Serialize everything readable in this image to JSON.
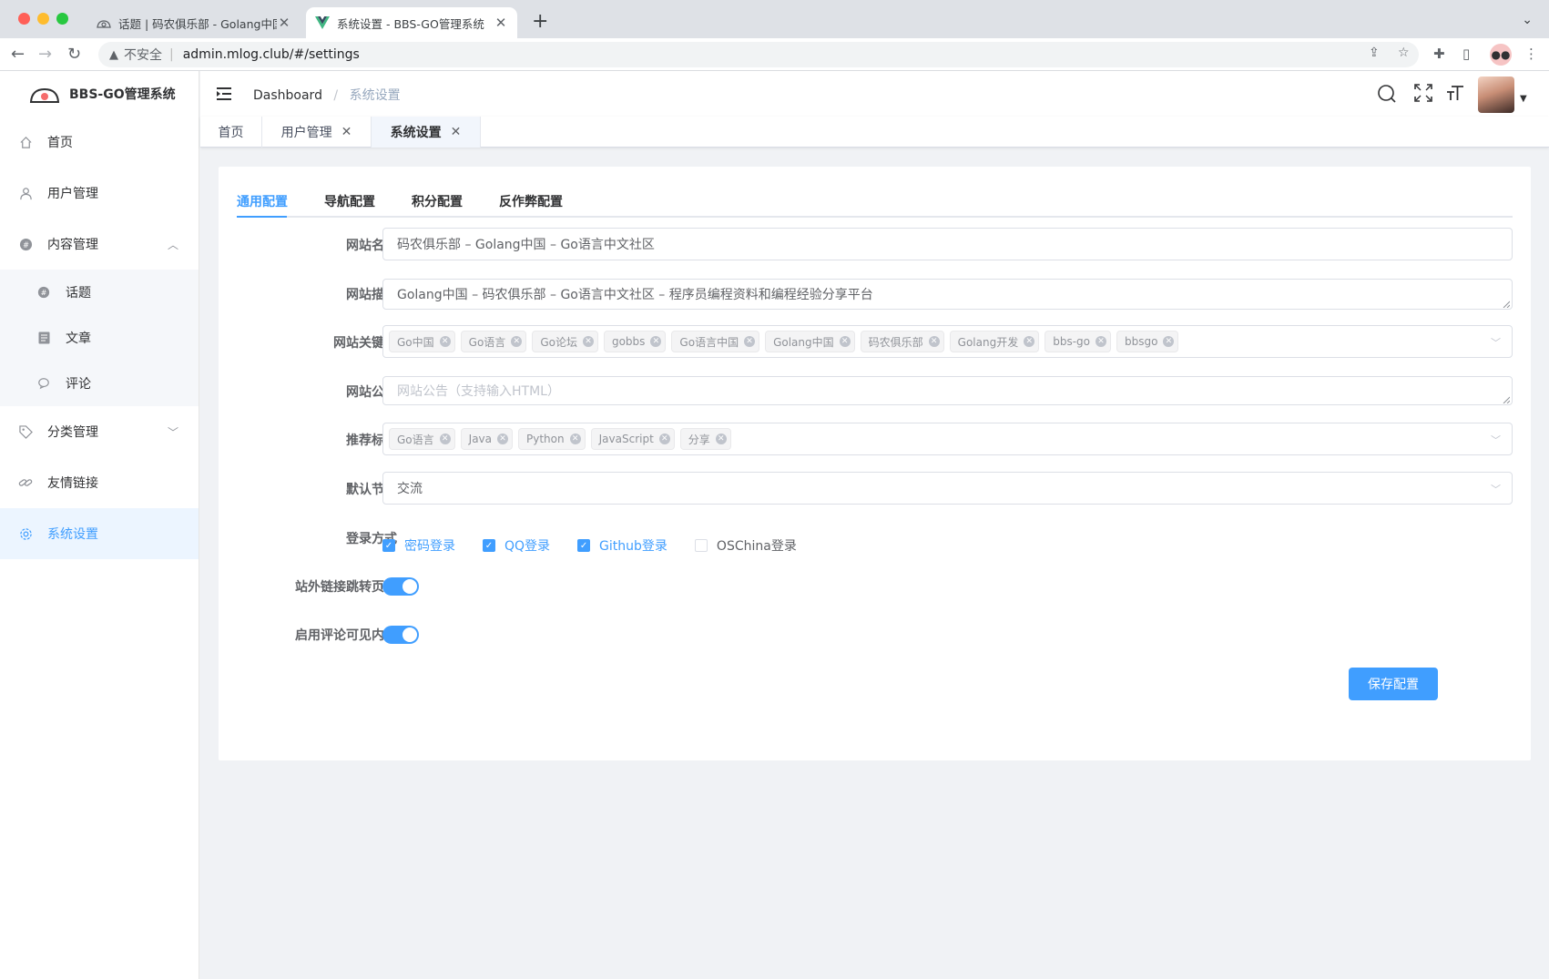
{
  "browser": {
    "tabs": [
      {
        "title": "话题 | 码农俱乐部 - Golang中国",
        "close": "✕"
      },
      {
        "title": "系统设置 - BBS-GO管理系统",
        "close": "✕"
      }
    ],
    "new_tab": "+",
    "insecure_label": "不安全",
    "url": "admin.mlog.club/#/settings"
  },
  "app": {
    "logo_text": "BBS-GO管理系统"
  },
  "sidebar": {
    "items": [
      {
        "label": "首页",
        "icon": "home-icon"
      },
      {
        "label": "用户管理",
        "icon": "user-icon"
      },
      {
        "label": "内容管理",
        "icon": "content-icon"
      },
      {
        "label": "分类管理",
        "icon": "tag-icon"
      },
      {
        "label": "友情链接",
        "icon": "link-icon"
      },
      {
        "label": "系统设置",
        "icon": "gear-icon"
      }
    ],
    "content_children": [
      {
        "label": "话题",
        "icon": "topic-icon"
      },
      {
        "label": "文章",
        "icon": "article-icon"
      },
      {
        "label": "评论",
        "icon": "comment-icon"
      }
    ]
  },
  "breadcrumb": {
    "root": "Dashboard",
    "separator": "/",
    "current": "系统设置"
  },
  "tagsview": {
    "tabs": [
      {
        "label": "首页"
      },
      {
        "label": "用户管理",
        "close": "✕"
      },
      {
        "label": "系统设置",
        "close": "✕"
      }
    ]
  },
  "settings": {
    "tabs": [
      "通用配置",
      "导航配置",
      "积分配置",
      "反作弊配置"
    ],
    "site_name": {
      "label": "网站名称",
      "value": "码农俱乐部  – Golang中国 – Go语言中文社区"
    },
    "site_desc": {
      "label": "网站描述",
      "value": "Golang中国 – 码农俱乐部 – Go语言中文社区 – 程序员编程资料和编程经验分享平台"
    },
    "site_keywords": {
      "label": "网站关键字",
      "values": [
        "Go中国",
        "Go语言",
        "Go论坛",
        "gobbs",
        "Go语言中国",
        "Golang中国",
        "码农俱乐部",
        "Golang开发",
        "bbs-go",
        "bbsgo"
      ]
    },
    "site_notice": {
      "label": "网站公告",
      "placeholder": "网站公告（支持输入HTML）"
    },
    "recommend_tags": {
      "label": "推荐标签",
      "values": [
        "Go语言",
        "Java",
        "Python",
        "JavaScript",
        "分享"
      ]
    },
    "default_node": {
      "label": "默认节点",
      "value": "交流"
    },
    "login_methods": {
      "label": "登录方式",
      "options": [
        {
          "label": "密码登录",
          "checked": true
        },
        {
          "label": "QQ登录",
          "checked": true
        },
        {
          "label": "Github登录",
          "checked": true
        },
        {
          "label": "OSChina登录",
          "checked": false
        }
      ]
    },
    "url_redirect": {
      "label": "站外链接跳转页面",
      "on": true
    },
    "comment_visible": {
      "label": "启用评论可见内容",
      "on": true
    },
    "save_label": "保存配置"
  },
  "colors": {
    "primary": "#409eff",
    "menu_active_bg": "#ecf5ff",
    "page_bg": "#f0f2f5"
  }
}
